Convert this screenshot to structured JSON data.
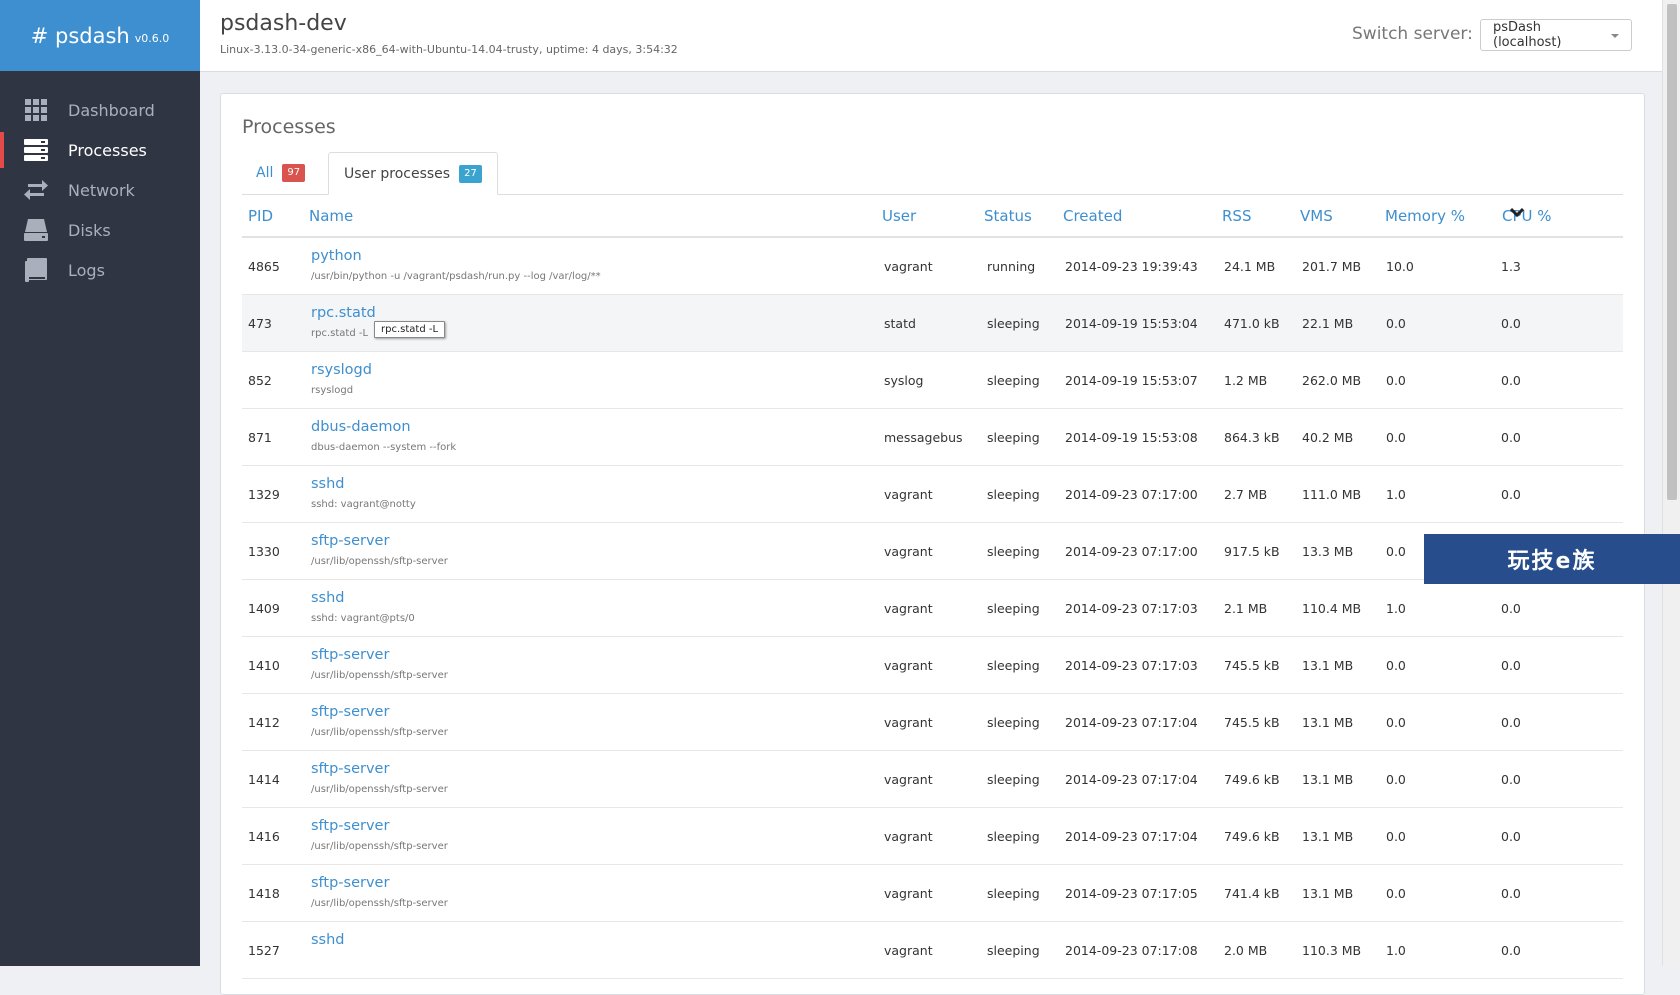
{
  "brand": {
    "name": "# psdash",
    "version": "v0.6.0"
  },
  "sidebar": {
    "items": [
      {
        "label": "Dashboard",
        "icon": "grid-icon",
        "active": false
      },
      {
        "label": "Processes",
        "icon": "server-stack-icon",
        "active": true
      },
      {
        "label": "Network",
        "icon": "exchange-arrows-icon",
        "active": false
      },
      {
        "label": "Disks",
        "icon": "hard-drive-icon",
        "active": false
      },
      {
        "label": "Logs",
        "icon": "book-icon",
        "active": false
      }
    ]
  },
  "header": {
    "host": "psdash-dev",
    "sysinfo": "Linux-3.13.0-34-generic-x86_64-with-Ubuntu-14.04-trusty, uptime: 4 days, 3:54:32",
    "switch_label": "Switch server:",
    "server_selected": "psDash (localhost)"
  },
  "panel": {
    "title": "Processes",
    "tabs": [
      {
        "label": "All",
        "count": "97",
        "badge_color": "#d9534f"
      },
      {
        "label": "User processes",
        "count": "27",
        "badge_color": "#3ba3d0"
      }
    ]
  },
  "table": {
    "columns": [
      "PID",
      "Name",
      "User",
      "Status",
      "Created",
      "RSS",
      "VMS",
      "Memory %",
      "CPU %"
    ],
    "rows": [
      {
        "pid": "4865",
        "name": "python",
        "cmd": "/usr/bin/python -u /vagrant/psdash/run.py --log /var/log/**",
        "user": "vagrant",
        "status": "running",
        "created": "2014-09-23 19:39:43",
        "rss": "24.1 MB",
        "vms": "201.7 MB",
        "mem": "10.0",
        "cpu": "1.3"
      },
      {
        "pid": "473",
        "name": "rpc.statd",
        "cmd": "rpc.statd -L",
        "user": "statd",
        "status": "sleeping",
        "created": "2014-09-19 15:53:04",
        "rss": "471.0 kB",
        "vms": "22.1 MB",
        "mem": "0.0",
        "cpu": "0.0"
      },
      {
        "pid": "852",
        "name": "rsyslogd",
        "cmd": "rsyslogd",
        "user": "syslog",
        "status": "sleeping",
        "created": "2014-09-19 15:53:07",
        "rss": "1.2 MB",
        "vms": "262.0 MB",
        "mem": "0.0",
        "cpu": "0.0"
      },
      {
        "pid": "871",
        "name": "dbus-daemon",
        "cmd": "dbus-daemon --system --fork",
        "user": "messagebus",
        "status": "sleeping",
        "created": "2014-09-19 15:53:08",
        "rss": "864.3 kB",
        "vms": "40.2 MB",
        "mem": "0.0",
        "cpu": "0.0"
      },
      {
        "pid": "1329",
        "name": "sshd",
        "cmd": "sshd: vagrant@notty",
        "user": "vagrant",
        "status": "sleeping",
        "created": "2014-09-23 07:17:00",
        "rss": "2.7 MB",
        "vms": "111.0 MB",
        "mem": "1.0",
        "cpu": "0.0"
      },
      {
        "pid": "1330",
        "name": "sftp-server",
        "cmd": "/usr/lib/openssh/sftp-server",
        "user": "vagrant",
        "status": "sleeping",
        "created": "2014-09-23 07:17:00",
        "rss": "917.5 kB",
        "vms": "13.3 MB",
        "mem": "0.0",
        "cpu": ""
      },
      {
        "pid": "1409",
        "name": "sshd",
        "cmd": "sshd: vagrant@pts/0",
        "user": "vagrant",
        "status": "sleeping",
        "created": "2014-09-23 07:17:03",
        "rss": "2.1 MB",
        "vms": "110.4 MB",
        "mem": "1.0",
        "cpu": "0.0"
      },
      {
        "pid": "1410",
        "name": "sftp-server",
        "cmd": "/usr/lib/openssh/sftp-server",
        "user": "vagrant",
        "status": "sleeping",
        "created": "2014-09-23 07:17:03",
        "rss": "745.5 kB",
        "vms": "13.1 MB",
        "mem": "0.0",
        "cpu": "0.0"
      },
      {
        "pid": "1412",
        "name": "sftp-server",
        "cmd": "/usr/lib/openssh/sftp-server",
        "user": "vagrant",
        "status": "sleeping",
        "created": "2014-09-23 07:17:04",
        "rss": "745.5 kB",
        "vms": "13.1 MB",
        "mem": "0.0",
        "cpu": "0.0"
      },
      {
        "pid": "1414",
        "name": "sftp-server",
        "cmd": "/usr/lib/openssh/sftp-server",
        "user": "vagrant",
        "status": "sleeping",
        "created": "2014-09-23 07:17:04",
        "rss": "749.6 kB",
        "vms": "13.1 MB",
        "mem": "0.0",
        "cpu": "0.0"
      },
      {
        "pid": "1416",
        "name": "sftp-server",
        "cmd": "/usr/lib/openssh/sftp-server",
        "user": "vagrant",
        "status": "sleeping",
        "created": "2014-09-23 07:17:04",
        "rss": "749.6 kB",
        "vms": "13.1 MB",
        "mem": "0.0",
        "cpu": "0.0"
      },
      {
        "pid": "1418",
        "name": "sftp-server",
        "cmd": "/usr/lib/openssh/sftp-server",
        "user": "vagrant",
        "status": "sleeping",
        "created": "2014-09-23 07:17:05",
        "rss": "741.4 kB",
        "vms": "13.1 MB",
        "mem": "0.0",
        "cpu": "0.0"
      },
      {
        "pid": "1527",
        "name": "sshd",
        "cmd": "",
        "user": "vagrant",
        "status": "sleeping",
        "created": "2014-09-23 07:17:08",
        "rss": "2.0 MB",
        "vms": "110.3 MB",
        "mem": "1.0",
        "cpu": "0.0"
      }
    ]
  },
  "tooltip": {
    "text": "rpc.statd -L"
  },
  "watermark": {
    "text": "玩技e族"
  },
  "colors": {
    "accent": "#3e8fcf",
    "sidebar_bg": "#2f3542",
    "active_marker": "#e34b4b"
  }
}
